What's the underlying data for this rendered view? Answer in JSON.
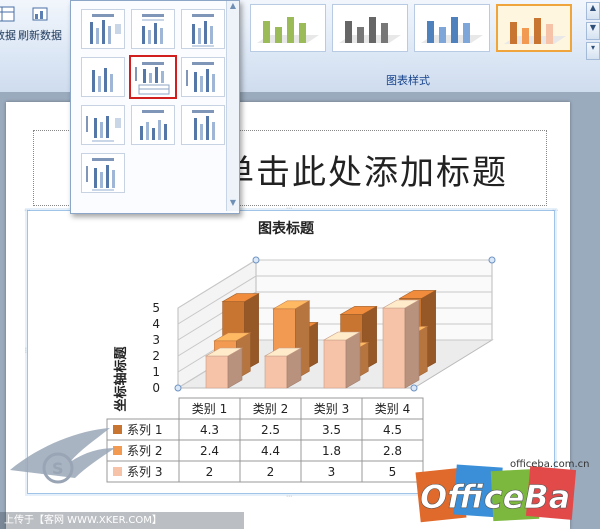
{
  "ribbon": {
    "data_group": {
      "btn1_label": "数据",
      "btn2_label": "刷新数据"
    },
    "gallery_label": "图表样式",
    "style_count": 4,
    "selected_style": 4
  },
  "layout_dropdown": {
    "selected_index": 4
  },
  "slide": {
    "title_placeholder": "单击此处添加标题"
  },
  "chart_data": {
    "type": "bar",
    "title": "图表标题",
    "ylabel": "坐标轴标题",
    "ylim": [
      0,
      5
    ],
    "yticks": [
      "0",
      "1",
      "2",
      "3",
      "4",
      "5"
    ],
    "categories": [
      "类别 1",
      "类别 2",
      "类别 3",
      "类别 4"
    ],
    "series": [
      {
        "name": "系列 1",
        "values": [
          4.3,
          2.5,
          3.5,
          4.5
        ],
        "color": "#c87532"
      },
      {
        "name": "系列 2",
        "values": [
          2.4,
          4.4,
          1.8,
          2.8
        ],
        "color": "#f39a52"
      },
      {
        "name": "系列 3",
        "values": [
          2,
          2,
          3,
          5
        ],
        "color": "#f7c3a8"
      }
    ],
    "data_table": true
  },
  "watermark": {
    "uploader": "上传于【客网 WWW.XKER.COM】",
    "site": "officeba.com.cn",
    "brand": "OfficeBa"
  }
}
